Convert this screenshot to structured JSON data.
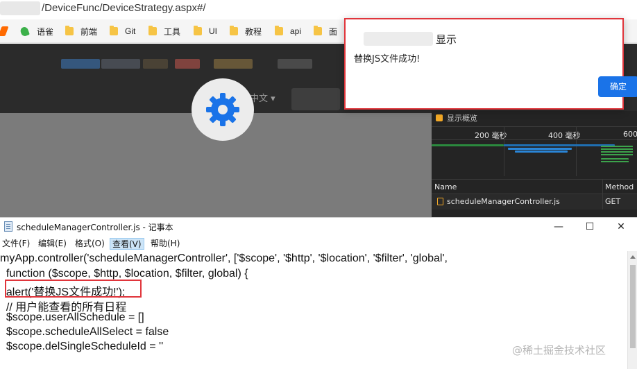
{
  "browser": {
    "url": "/DeviceFunc/DeviceStrategy.aspx#/",
    "bookmarks": [
      "语雀",
      "前端",
      "Git",
      "工具",
      "UI",
      "教程",
      "api",
      "面"
    ]
  },
  "page": {
    "language": "中文 ▾",
    "colors": {
      "accent": "#1a73e8",
      "highlight": "#e0353b"
    }
  },
  "devtools": {
    "overview_label": "显示概览",
    "ticks": [
      "200 毫秒",
      "400 毫秒",
      "600"
    ],
    "columns": {
      "name": "Name",
      "method": "Method"
    },
    "requests": [
      {
        "name": "scheduleManagerController.js",
        "method": "GET"
      }
    ]
  },
  "alert": {
    "title": "显示",
    "message": "替换JS文件成功!",
    "ok_label": "确定"
  },
  "notepad": {
    "title": "scheduleManagerController.js - 记事本",
    "window_controls": {
      "minimize": "—",
      "maximize": "☐",
      "close": "✕"
    },
    "menu": [
      "文件(F)",
      "编辑(E)",
      "格式(O)",
      "查看(V)",
      "帮助(H)"
    ],
    "lines": [
      "myApp.controller('scheduleManagerController', ['$scope', '$http', '$location', '$filter', 'global',",
      "  function ($scope, $http, $location, $filter, global) {",
      "  alert('替换JS文件成功!');",
      "  // 用户能查看的所有日程",
      "  $scope.userAllSchedule = []",
      "  $scope.scheduleAllSelect = false",
      "  $scope.delSingleScheduleId = ''"
    ]
  },
  "watermark": "@稀土掘金技术社区"
}
